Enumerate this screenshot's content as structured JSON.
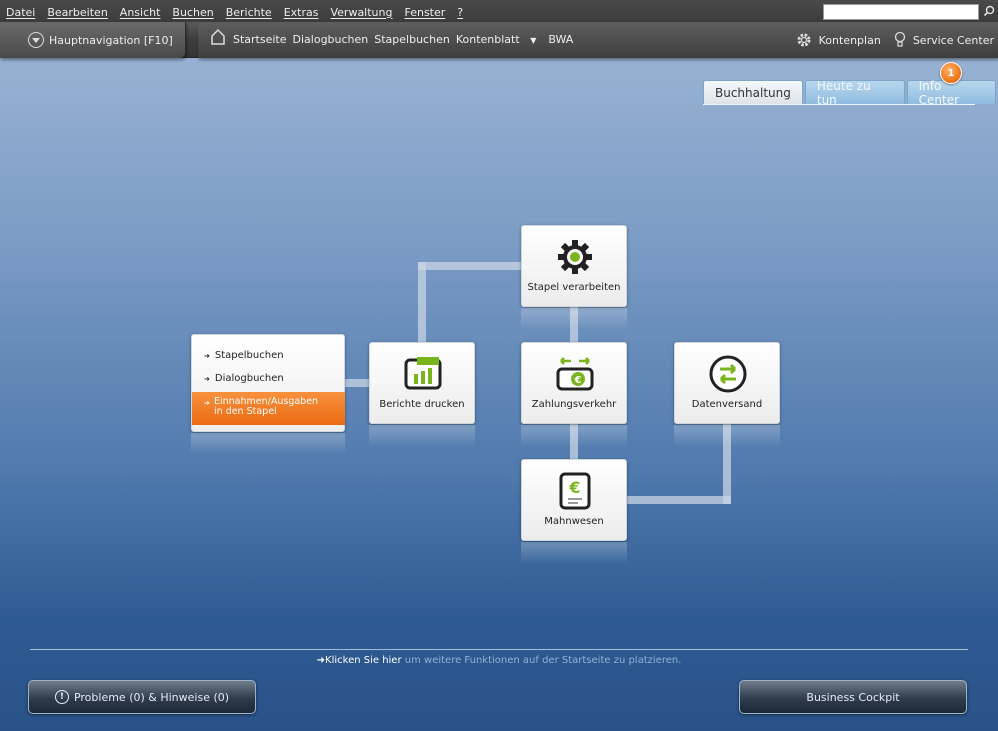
{
  "menubar": {
    "items": [
      "Datei",
      "Bearbeiten",
      "Ansicht",
      "Buchen",
      "Berichte",
      "Extras",
      "Verwaltung",
      "Fenster",
      "?"
    ],
    "search_value": ""
  },
  "toolbar": {
    "hauptnavigation_label": "Hauptnavigation [F10]",
    "nav_links": [
      "Startseite",
      "Dialogbuchen",
      "Stapelbuchen",
      "Kontenblatt",
      "BWA"
    ],
    "kontenplan_label": "Kontenplan",
    "service_center_label": "Service Center"
  },
  "tabs": {
    "items": [
      "Buchhaltung",
      "Heute zu tun",
      "Info Center"
    ],
    "active": "Buchhaltung",
    "badge_count": "1"
  },
  "menu_card": {
    "items": [
      "Stapelbuchen",
      "Dialogbuchen"
    ],
    "active_item_line1": "Einnahmen/Ausgaben",
    "active_item_line2": "in den Stapel"
  },
  "cards": {
    "stapel": "Stapel verarbeiten",
    "berichte": "Berichte drucken",
    "zahlung": "Zahlungsverkehr",
    "daten": "Datenversand",
    "mahn": "Mahnwesen"
  },
  "footer": {
    "hint_link": "Klicken Sie hier",
    "hint_text": " um weitere Funktionen auf der Startseite zu platzieren.",
    "problems_label": "Probleme (0) & Hinweise (0)",
    "cockpit_label": "Business Cockpit"
  },
  "colors": {
    "accent_orange": "#ec6a12",
    "icon_green": "#7ab51d"
  }
}
